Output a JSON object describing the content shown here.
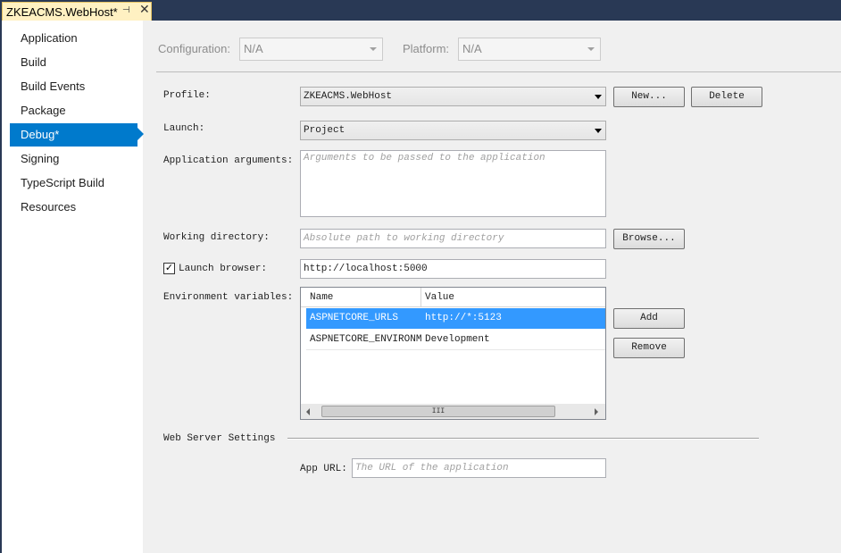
{
  "tab": {
    "title": "ZKEACMS.WebHost*",
    "pin_glyph": "⊣",
    "close_glyph": "✕"
  },
  "nav": {
    "items": [
      {
        "label": "Application"
      },
      {
        "label": "Build"
      },
      {
        "label": "Build Events"
      },
      {
        "label": "Package"
      },
      {
        "label": "Debug*",
        "active": true
      },
      {
        "label": "Signing"
      },
      {
        "label": "TypeScript Build"
      },
      {
        "label": "Resources"
      }
    ]
  },
  "config": {
    "configuration_label": "Configuration:",
    "configuration_value": "N/A",
    "platform_label": "Platform:",
    "platform_value": "N/A"
  },
  "profile": {
    "label": "Profile:",
    "value": "ZKEACMS.WebHost",
    "new_button": "New...",
    "delete_button": "Delete"
  },
  "launch": {
    "label": "Launch:",
    "value": "Project"
  },
  "app_args": {
    "label": "Application arguments:",
    "placeholder": "Arguments to be passed to the application"
  },
  "working_dir": {
    "label": "Working directory:",
    "placeholder": "Absolute path to working directory",
    "browse_button": "Browse..."
  },
  "launch_browser": {
    "label": "Launch browser:",
    "checked": true,
    "value": "http://localhost:5000"
  },
  "env": {
    "label": "Environment variables:",
    "columns": [
      "Name",
      "Value"
    ],
    "rows": [
      {
        "name": "ASPNETCORE_URLS",
        "value": "http://*:5123",
        "selected": true
      },
      {
        "name": "ASPNETCORE_ENVIRONMENT",
        "value": "Development",
        "selected": false
      }
    ],
    "add_button": "Add",
    "remove_button": "Remove",
    "scroll_thumb": "III"
  },
  "web_server": {
    "heading": "Web Server Settings",
    "app_url_label": "App URL:",
    "app_url_placeholder": "The URL of the application"
  },
  "colors": {
    "accent": "#007acc",
    "selection": "#3399ff",
    "tab_active": "#fff1c2",
    "chrome": "#293955"
  }
}
